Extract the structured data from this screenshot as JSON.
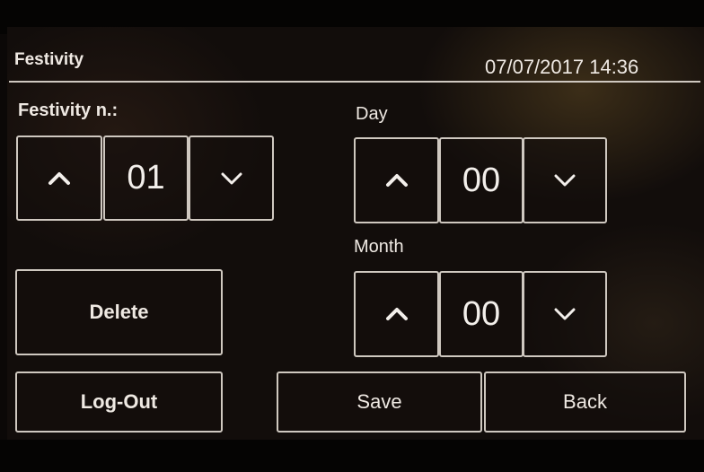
{
  "header": {
    "title": "Festivity",
    "datetime": "07/07/2017 14:36"
  },
  "festivity": {
    "label": "Festivity n.:",
    "value": "01"
  },
  "day": {
    "label": "Day",
    "value": "00"
  },
  "month": {
    "label": "Month",
    "value": "00"
  },
  "buttons": {
    "delete": "Delete",
    "logout": "Log-Out",
    "save": "Save",
    "back": "Back"
  },
  "icons": {
    "up": "chevron-up-icon",
    "down": "chevron-down-icon"
  }
}
